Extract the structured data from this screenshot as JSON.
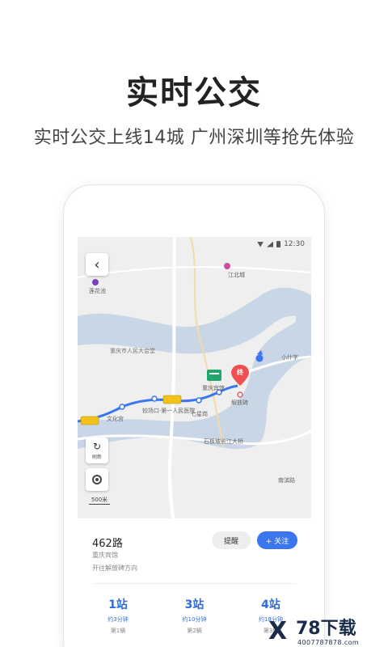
{
  "hero": {
    "title": "实时公交",
    "subtitle": "实时公交上线14城 广州深圳等抢先体验"
  },
  "status_bar": {
    "time": "12:30"
  },
  "map": {
    "back_icon": "chevron-left-icon",
    "refresh_label": "刷新",
    "scale_label": "500米",
    "labels": {
      "jiangbei": "江北城",
      "lianhuachi": "莲花池",
      "people_hall": "重庆市人民大会堂",
      "xiaoshizi": "小什字",
      "hotel": "重庆宾馆",
      "jiefangbei": "解放碑",
      "qixinggang": "七星岗",
      "wenhuagong": "文化宫",
      "hospital": "较场口·第一人民医院",
      "bridge": "石板坡长江大桥",
      "nanbin": "南滨路"
    },
    "end_marker": "终",
    "colors": {
      "water": "#c9d6e6",
      "land": "#efefef",
      "route": "#3a76f0",
      "bus": "#f2c21b",
      "end_pin": "#f05050",
      "station": "#21a66b"
    }
  },
  "route": {
    "name": "462路",
    "destination": "重庆宾馆",
    "direction": "开往解放碑方向",
    "remind_label": "提醒",
    "follow_label": "+ 关注"
  },
  "arrivals": [
    {
      "stops": "1站",
      "time": "约3分钟",
      "car": "第1辆"
    },
    {
      "stops": "3站",
      "time": "约10分钟",
      "car": "第2辆"
    },
    {
      "stops": "4站",
      "time": "约18分钟",
      "car": "第3辆"
    }
  ],
  "watermark": {
    "logo_mark": "X",
    "text": "78下载",
    "phone": "4007787878.com"
  }
}
